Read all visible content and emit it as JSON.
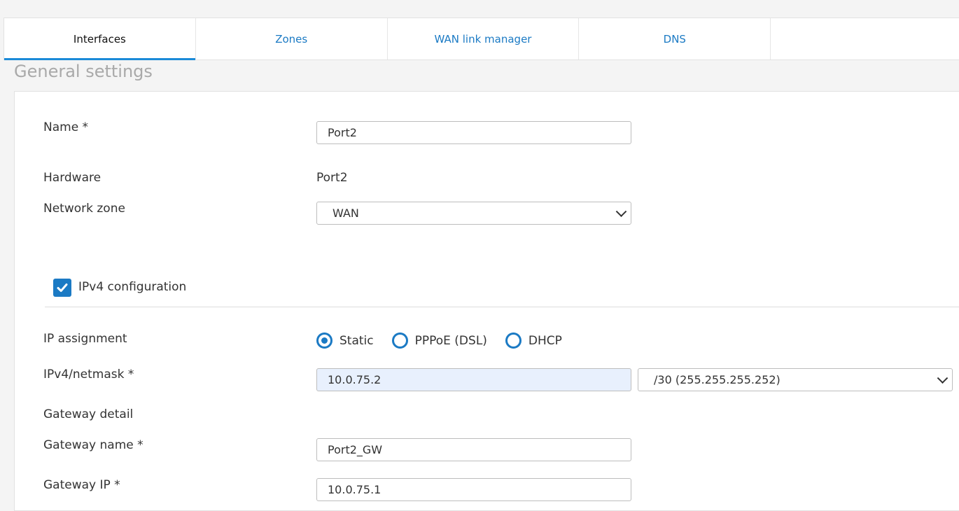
{
  "tabs": [
    {
      "label": "Interfaces",
      "active": true
    },
    {
      "label": "Zones",
      "active": false
    },
    {
      "label": "WAN link manager",
      "active": false
    },
    {
      "label": "DNS",
      "active": false
    }
  ],
  "section_title": "General settings",
  "form": {
    "name_label": "Name *",
    "name_value": "Port2",
    "hardware_label": "Hardware",
    "hardware_value": "Port2",
    "network_zone_label": "Network zone",
    "network_zone_value": "WAN",
    "ipv4_config_label": "IPv4 configuration",
    "ipv4_config_checked": true,
    "ip_assignment_label": "IP assignment",
    "ip_assignment_options": [
      "Static",
      "PPPoE (DSL)",
      "DHCP"
    ],
    "ip_assignment_selected": "Static",
    "ipv4_netmask_label": "IPv4/netmask *",
    "ipv4_value": "10.0.75.2",
    "netmask_value": "/30 (255.255.255.252)",
    "gateway_detail_label": "Gateway detail",
    "gateway_name_label": "Gateway name *",
    "gateway_name_value": "Port2_GW",
    "gateway_ip_label": "Gateway IP *",
    "gateway_ip_value": "10.0.75.1"
  },
  "colors": {
    "accent": "#1b7ac4",
    "tab_underline": "#1b8ad8",
    "autofill_bg": "#e8f0fd"
  }
}
